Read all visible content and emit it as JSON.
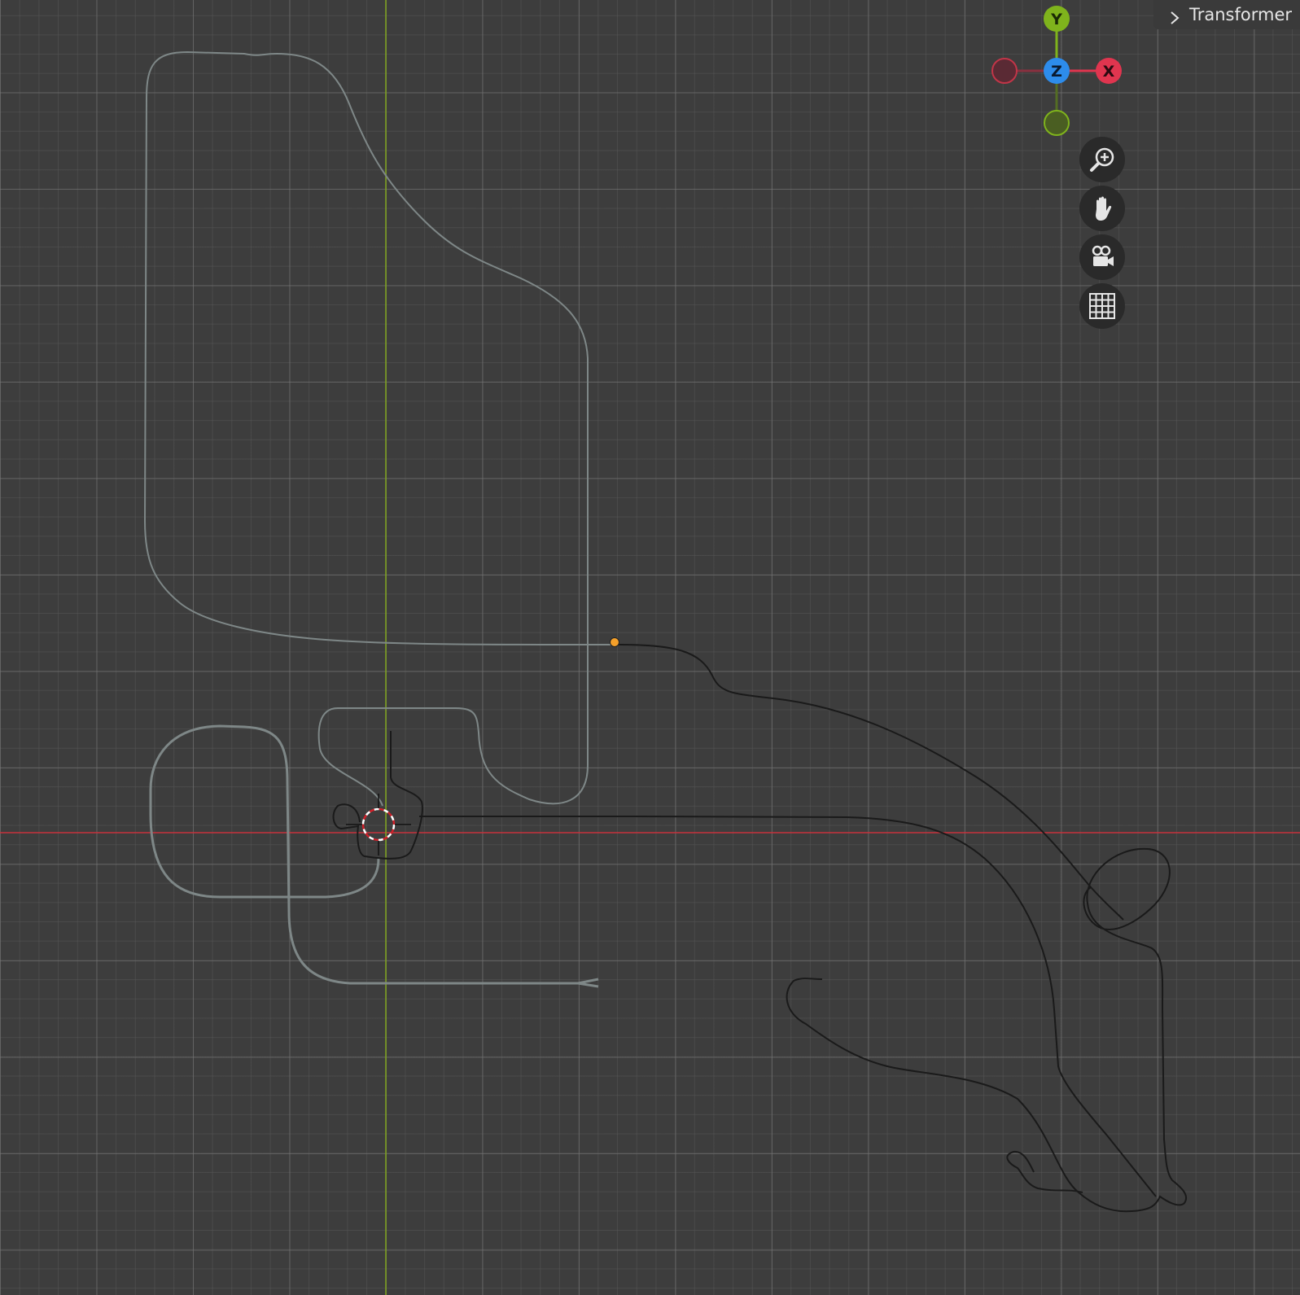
{
  "npanel": {
    "tab_label": "Transformer"
  },
  "gizmo": {
    "x_label": "X",
    "y_label": "Y",
    "z_label": "Z",
    "colors": {
      "x": "#e0354f",
      "y": "#7fb31c",
      "z": "#2d8ceb",
      "x_neg": "#8a3140",
      "y_neg": "#546d24"
    }
  },
  "nav_buttons": [
    {
      "icon": "zoom-icon"
    },
    {
      "icon": "hand-pan-icon"
    },
    {
      "icon": "camera-icon"
    },
    {
      "icon": "grid-ortho-icon"
    }
  ],
  "scene": {
    "colors": {
      "background": "#3d3d3d",
      "x_axis": "#c8323c",
      "y_axis": "#7fa31c",
      "curve_gray": "#7e8787",
      "curve_dark": "#1a1a1a",
      "origin_point": "#f5a02a"
    }
  }
}
